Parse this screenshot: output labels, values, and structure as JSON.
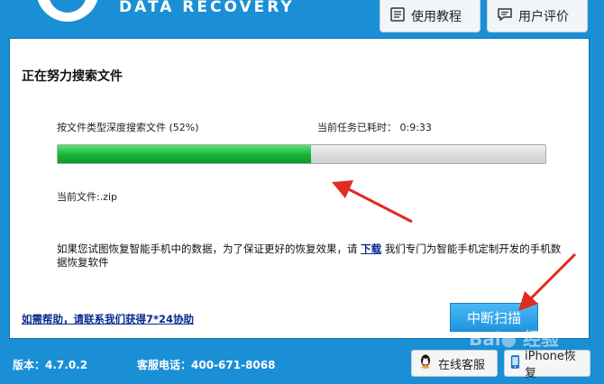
{
  "header": {
    "brand": "DATA RECOVERY",
    "tutorial_label": "使用教程",
    "review_label": "用户评价"
  },
  "main": {
    "status_title": "正在努力搜索文件",
    "task_label": "按文件类型深度搜索文件 (52%)",
    "elapsed_label": "当前任务已耗时：",
    "elapsed_value": "0:9:33",
    "progress_percent": 52,
    "current_file_label": "当前文件:",
    "current_file_value": ".zip",
    "notice_before": "如果您试图恢复智能手机中的数据，为了保证更好的恢复效果，请",
    "notice_link": "下载",
    "notice_after": "我们专门为智能手机定制开发的手机数据恢复软件",
    "help_link": "如需帮助，请联系我们获得7*24协助",
    "stop_button": "中断扫描"
  },
  "footer": {
    "version": "版本：4.7.0.2",
    "phone_label": "客服电话：",
    "phone_value": "400-671-8068",
    "qq_button": "在线客服",
    "iphone_button": "iPhone恢复"
  },
  "colors": {
    "frame": "#1a8fd6",
    "progress": "#16b43a",
    "arrow": "#e02b20"
  }
}
